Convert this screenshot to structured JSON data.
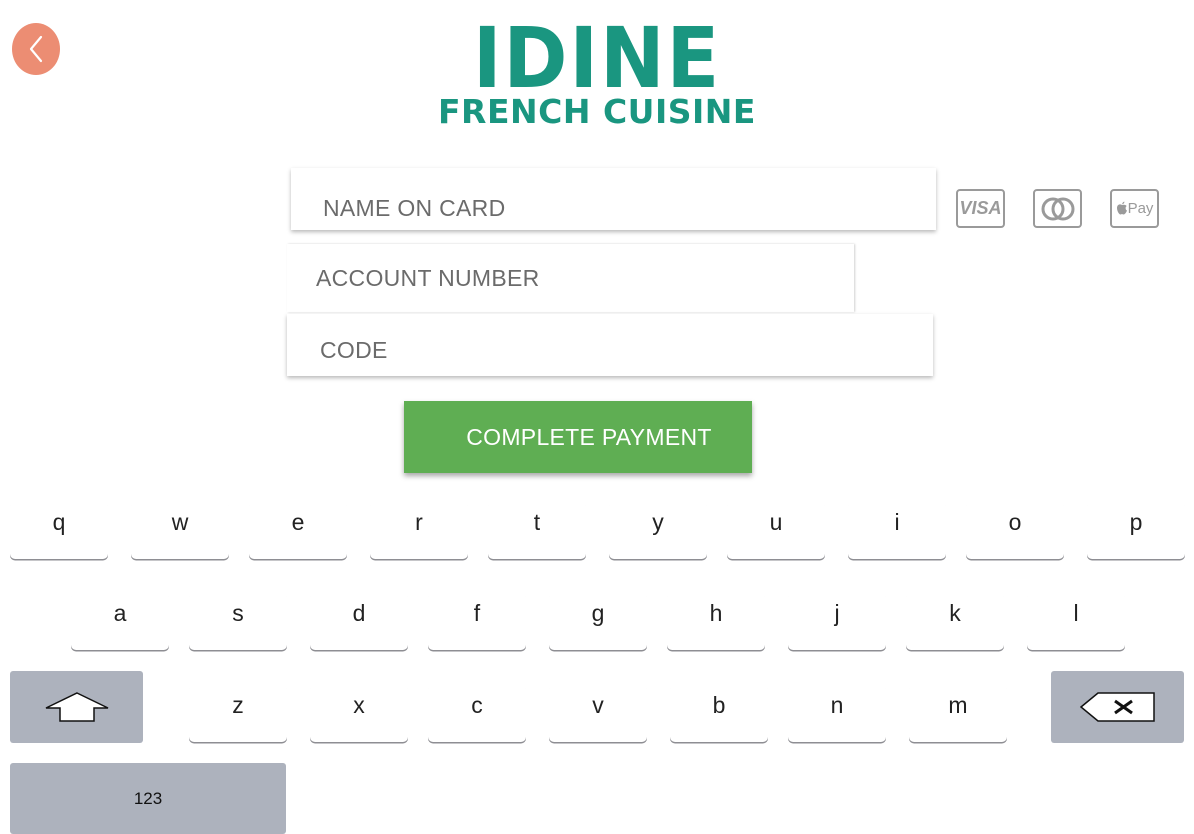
{
  "header": {
    "back_icon": "chevron-left-icon",
    "title": "IDINE",
    "subtitle": "FRENCH CUISINE"
  },
  "form": {
    "name_placeholder": "NAME ON CARD",
    "account_placeholder": "ACCOUNT NUMBER",
    "code_placeholder": "CODE",
    "submit_label": "COMPLETE PAYMENT"
  },
  "payment_methods": [
    {
      "name": "visa-icon",
      "label": "VISA"
    },
    {
      "name": "mastercard-icon",
      "label": ""
    },
    {
      "name": "apple-pay-icon",
      "label": "Pay"
    }
  ],
  "keyboard": {
    "row1": [
      "q",
      "w",
      "e",
      "r",
      "t",
      "y",
      "u",
      "i",
      "o",
      "p"
    ],
    "row2": [
      "a",
      "s",
      "d",
      "f",
      "g",
      "h",
      "j",
      "k",
      "l"
    ],
    "row3": [
      "z",
      "x",
      "c",
      "v",
      "b",
      "n",
      "m"
    ],
    "shift_icon": "shift-arrow-icon",
    "backspace_icon": "backspace-icon",
    "numbers_label": "123"
  },
  "colors": {
    "brand": "#1a9680",
    "back_button": "#ec8d73",
    "submit_button": "#5fae53",
    "keyboard_special_key": "#adb2bd"
  }
}
